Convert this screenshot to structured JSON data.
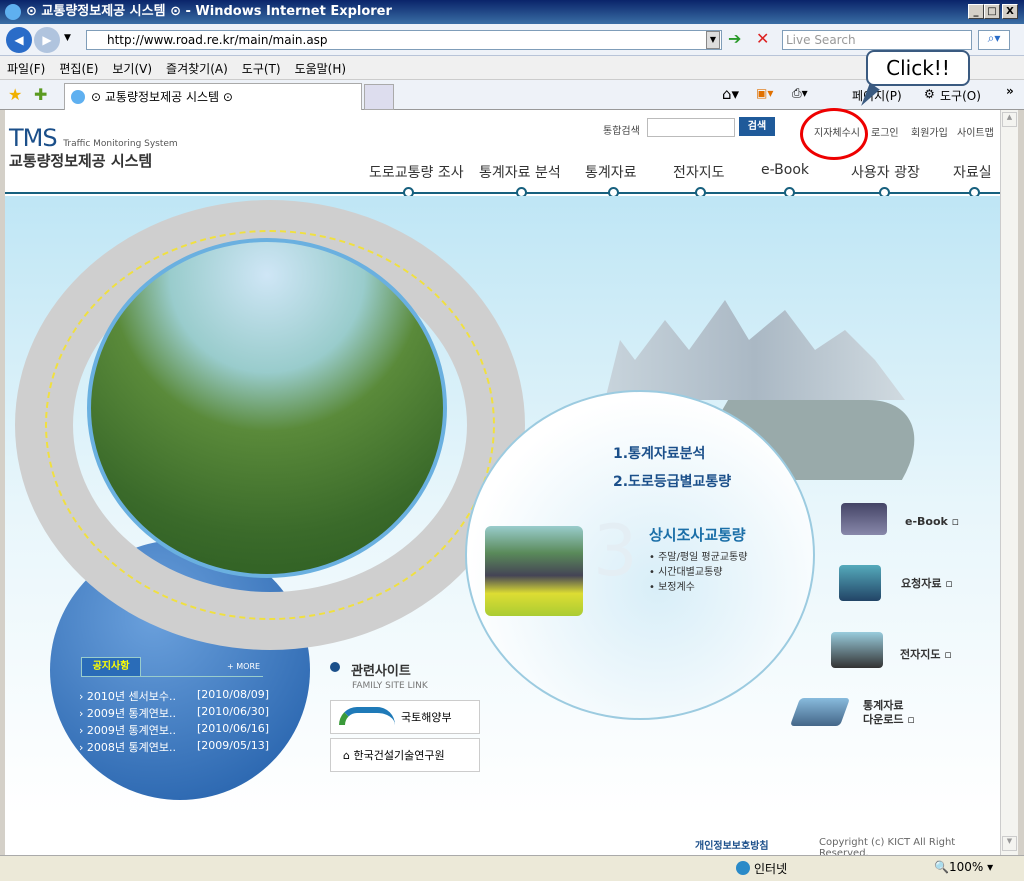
{
  "window": {
    "title": "⊙ 교통량정보제공 시스템 ⊙ - Windows Internet Explorer",
    "min": "_",
    "max": "□",
    "close": "X"
  },
  "address": {
    "url": "http://www.road.re.kr/main/main.asp",
    "search_placeholder": "Live Search"
  },
  "menu": [
    "파일(F)",
    "편집(E)",
    "보기(V)",
    "즐겨찾기(A)",
    "도구(T)",
    "도움말(H)"
  ],
  "tab": {
    "label": "⊙ 교통량정보제공 시스템 ⊙"
  },
  "toolbar": {
    "page": "페이지(P)",
    "tools": "도구(O)",
    "more": "»"
  },
  "callout": "Click!!",
  "site": {
    "logo_main": "TMS",
    "logo_sub": "Traffic Monitoring System",
    "logo_kr": "교통량정보제공 시스템",
    "search_label": "통합검색",
    "search_button": "검색",
    "top_links": [
      "지자체수시",
      "로그인",
      "회원가입",
      "사이트맵"
    ],
    "nav": [
      "도로교통량 조사",
      "통계자료 분석",
      "통계자료",
      "전자지도",
      "e-Book",
      "사용자 광장",
      "자료실"
    ],
    "promo": {
      "item1": "1.통계자료분석",
      "item2": "2.도로등급별교통량",
      "num": "3",
      "title": "상시조사교통량",
      "bullets": [
        "• 주말/평일 평균교통량",
        "• 시간대별교통량",
        "• 보정계수"
      ]
    },
    "notice": {
      "title": "공지사항",
      "more": "+ MORE",
      "items": [
        {
          "title": "› 2010년 센서보수..",
          "date": "[2010/08/09]"
        },
        {
          "title": "› 2009년 통계연보..",
          "date": "[2010/06/30]"
        },
        {
          "title": "› 2009년 통계연보..",
          "date": "[2010/06/16]"
        },
        {
          "title": "› 2008년 통계연보..",
          "date": "[2009/05/13]"
        }
      ]
    },
    "family": {
      "title": "관련사이트",
      "subtitle": "FAMILY SITE LINK",
      "links": [
        "국토해양부",
        "한국건설기술연구원"
      ]
    },
    "quick": [
      "e-Book",
      "요청자료",
      "전자지도",
      "통계자료\n다운로드"
    ],
    "footer": {
      "privacy": "개인정보보호방침",
      "copyright": "Copyright (c) KICT All Right Reserved."
    }
  },
  "status": {
    "zone": "인터넷",
    "zoom": "100%"
  }
}
